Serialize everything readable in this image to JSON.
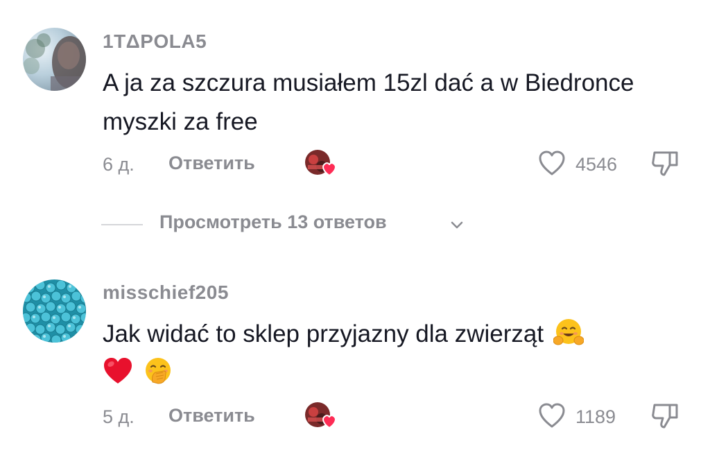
{
  "comments": [
    {
      "username": "1TΔPOLA5",
      "text": "A ja za szczura musiałem 15zl dać a w Biedronce myszki za free",
      "age": "6 д.",
      "reply_label": "Ответить",
      "likes": "4546",
      "avatar": "photo-avatar"
    },
    {
      "username": "misschief205",
      "text": "Jak widać to sklep przyjazny dla zwierząt",
      "emojis": [
        "smiling-face-with-open-hands",
        "red-heart",
        "face-with-hand-over-mouth"
      ],
      "age": "5 д.",
      "reply_label": "Ответить",
      "likes": "1189",
      "avatar": "blue-beads-avatar"
    }
  ],
  "view_replies": {
    "label": "Просмотреть 13 ответов"
  },
  "colors": {
    "muted": "#8a8b91",
    "text": "#161823",
    "like_heart": "#fe2c55"
  }
}
